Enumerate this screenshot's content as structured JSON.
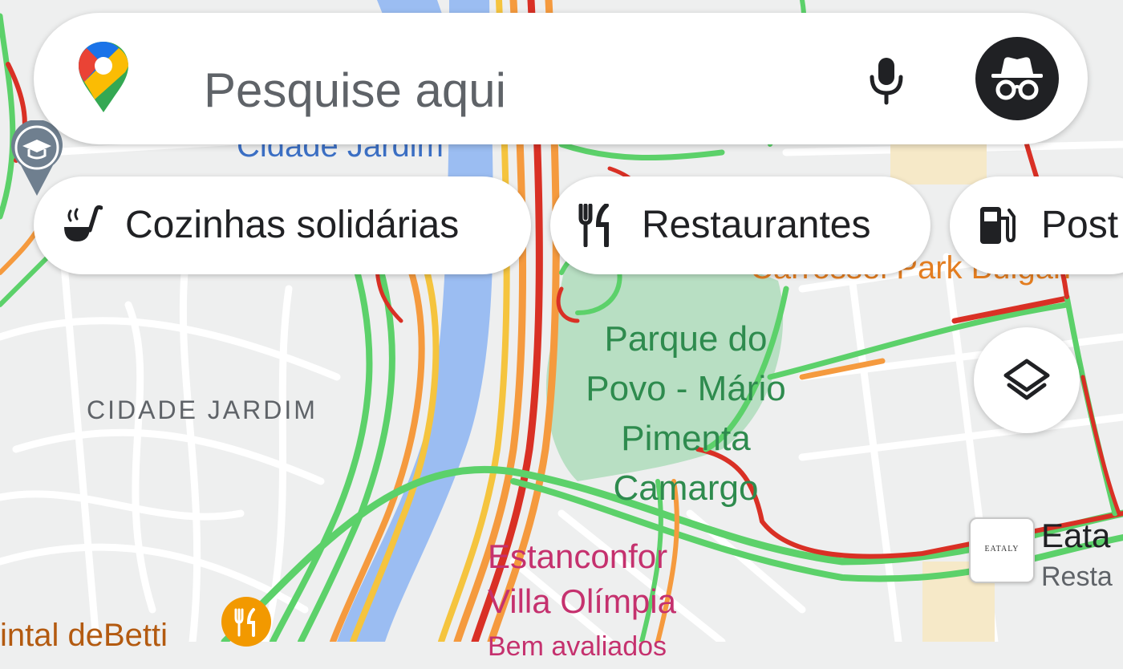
{
  "search": {
    "placeholder": "Pesquise aqui"
  },
  "chips": [
    {
      "label": "Cozinhas solidárias",
      "icon": "soup-ladle-icon"
    },
    {
      "label": "Restaurantes",
      "icon": "fork-knife-icon"
    },
    {
      "label": "Post",
      "icon": "gas-station-icon"
    }
  ],
  "map_labels": {
    "neighborhood_top": "Cidade Jardim",
    "neighborhood": "CIDADE JARDIM",
    "park_line1": "Parque do",
    "park_line2": "Povo - Mário",
    "park_line3": "Pimenta",
    "park_line4": "Camargo",
    "place_top_right": "Carrossel Park Bulgari",
    "poi_pink_line1": "Estanconfor",
    "poi_pink_line2": "Villa Olímpia",
    "poi_pink_line3": "Bem avaliados",
    "poi_bottom_left": "intal deBetti",
    "eataly_name": "Eata",
    "eataly_type": "Resta",
    "eataly_logo_text": "EATALY"
  },
  "colors": {
    "map_bg": "#eeefef",
    "river": "#9bbdf2",
    "park": "#b8dfc3",
    "traffic_green": "#5cd16a",
    "traffic_orange": "#f59a3e",
    "traffic_red": "#d93025",
    "park_label": "#2e8b4e",
    "poi_pink": "#c5316e",
    "poi_orange": "#f29900"
  }
}
